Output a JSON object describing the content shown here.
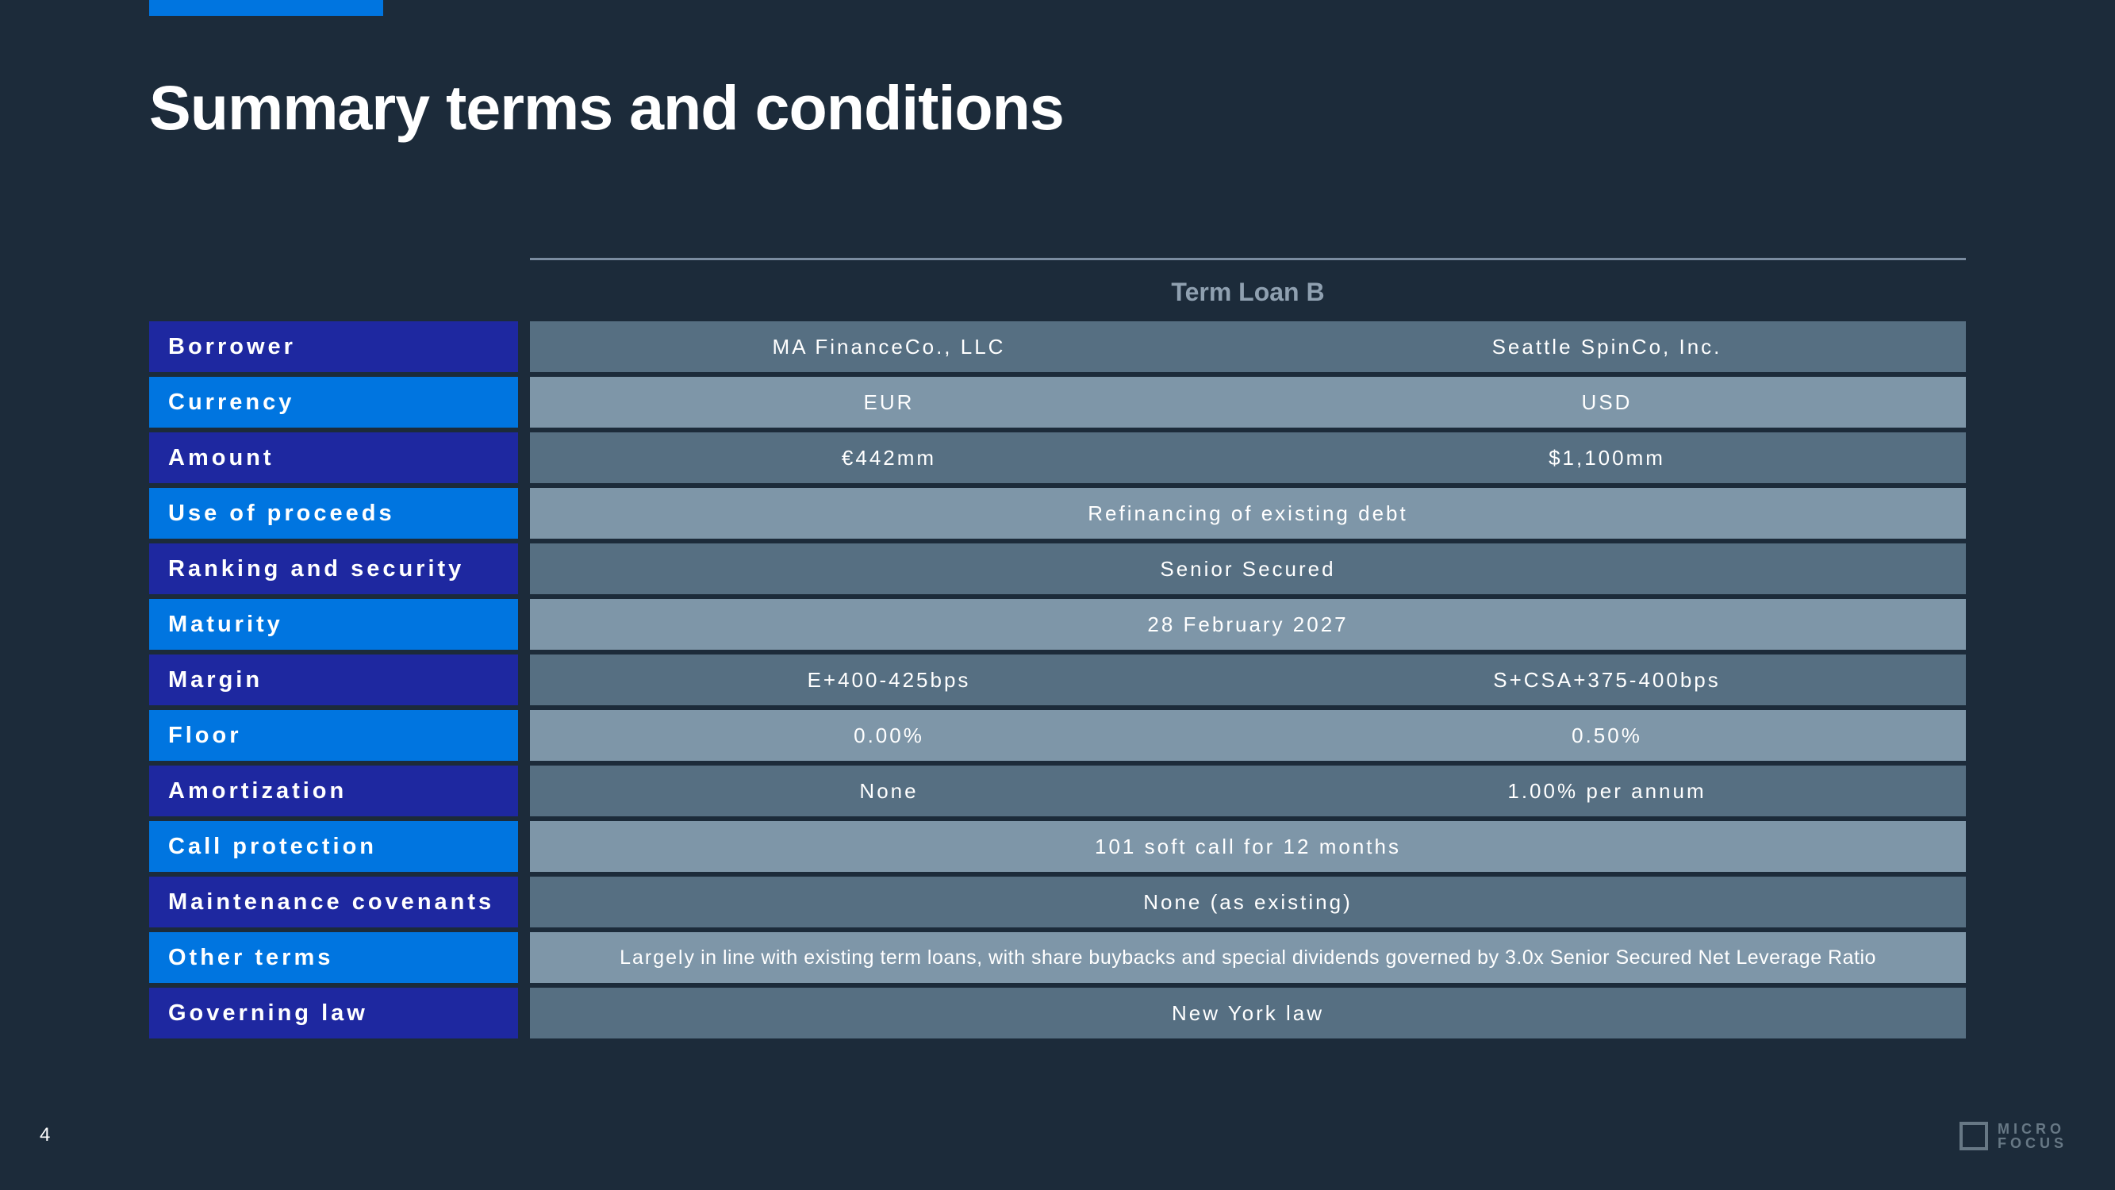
{
  "title": "Summary terms and conditions",
  "page_number": "4",
  "column_header": "Term Loan B",
  "logo": {
    "line1": "MICRO",
    "line2": "FOCUS"
  },
  "rows": [
    {
      "label": "Borrower",
      "label_style": "navy",
      "value_style": "dark",
      "type": "split",
      "value1": "MA FinanceCo., LLC",
      "value2": "Seattle SpinCo, Inc."
    },
    {
      "label": "Currency",
      "label_style": "blue",
      "value_style": "light",
      "type": "split",
      "value1": "EUR",
      "value2": "USD"
    },
    {
      "label": "Amount",
      "label_style": "navy",
      "value_style": "dark",
      "type": "split",
      "value1": "€442mm",
      "value2": "$1,100mm"
    },
    {
      "label": "Use of proceeds",
      "label_style": "blue",
      "value_style": "light",
      "type": "full",
      "value": "Refinancing of existing debt"
    },
    {
      "label": "Ranking and security",
      "label_style": "navy",
      "value_style": "dark",
      "type": "full",
      "value": "Senior Secured"
    },
    {
      "label": "Maturity",
      "label_style": "blue",
      "value_style": "light",
      "type": "full",
      "value": "28 February 2027"
    },
    {
      "label": "Margin",
      "label_style": "navy",
      "value_style": "dark",
      "type": "split",
      "value1": "E+400-425bps",
      "value2": "S+CSA+375-400bps"
    },
    {
      "label": "Floor",
      "label_style": "blue",
      "value_style": "light",
      "type": "split",
      "value1": "0.00%",
      "value2": "0.50%"
    },
    {
      "label": "Amortization",
      "label_style": "navy",
      "value_style": "dark",
      "type": "split",
      "value1": "None",
      "value2": "1.00% per annum"
    },
    {
      "label": "Call protection",
      "label_style": "blue",
      "value_style": "light",
      "type": "full",
      "value": "101 soft call for 12 months"
    },
    {
      "label": "Maintenance covenants",
      "label_style": "navy",
      "value_style": "dark",
      "type": "full",
      "value": "None (as existing)"
    },
    {
      "label": "Other terms",
      "label_style": "blue",
      "value_style": "light",
      "type": "other",
      "prefix": "Largely",
      "value": "in line with existing term loans, with share buybacks and special dividends governed by 3.0x Senior Secured Net Leverage Ratio"
    },
    {
      "label": "Governing law",
      "label_style": "navy",
      "value_style": "dark",
      "type": "full",
      "value": "New York law"
    }
  ]
}
